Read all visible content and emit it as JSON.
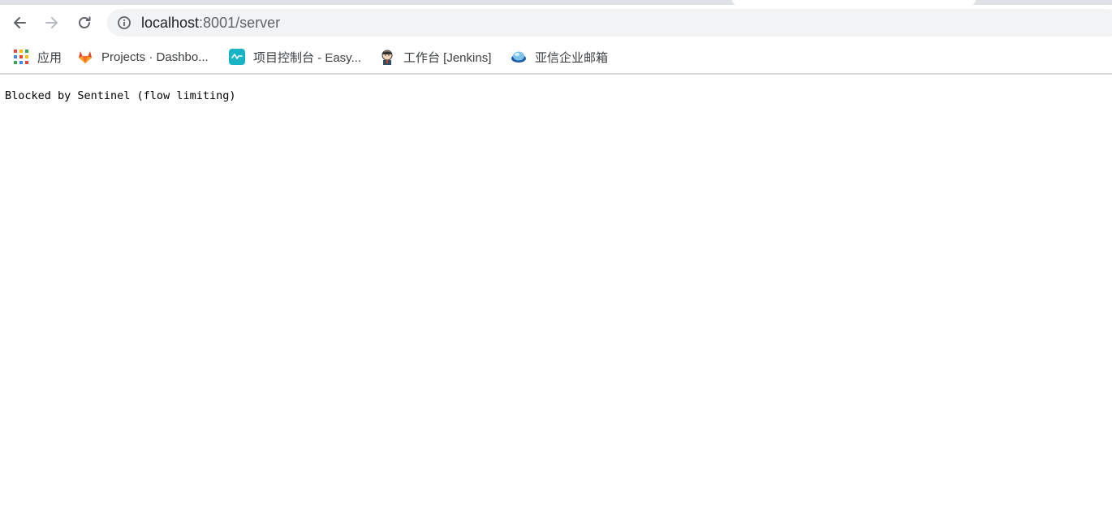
{
  "toolbar": {
    "back_icon": "arrow-left-icon",
    "forward_icon": "arrow-right-icon",
    "reload_icon": "reload-icon",
    "address": {
      "info_icon": "info-icon",
      "host": "localhost",
      "rest": ":8001/server"
    }
  },
  "bookmarks": {
    "items": [
      {
        "label": "应用",
        "icon": "apps-grid-icon"
      },
      {
        "label": "Projects · Dashbo...",
        "icon": "gitlab-icon"
      },
      {
        "label": "项目控制台 - Easy...",
        "icon": "easy-app-icon"
      },
      {
        "label": "工作台 [Jenkins]",
        "icon": "jenkins-icon"
      },
      {
        "label": "亚信企业邮箱",
        "icon": "mail-icon"
      }
    ]
  },
  "page": {
    "message": "Blocked by Sentinel (flow limiting)"
  },
  "colors": {
    "omnibox_bg": "#f1f3f4",
    "tabstrip": "#dee1e6",
    "text": "#202124"
  }
}
